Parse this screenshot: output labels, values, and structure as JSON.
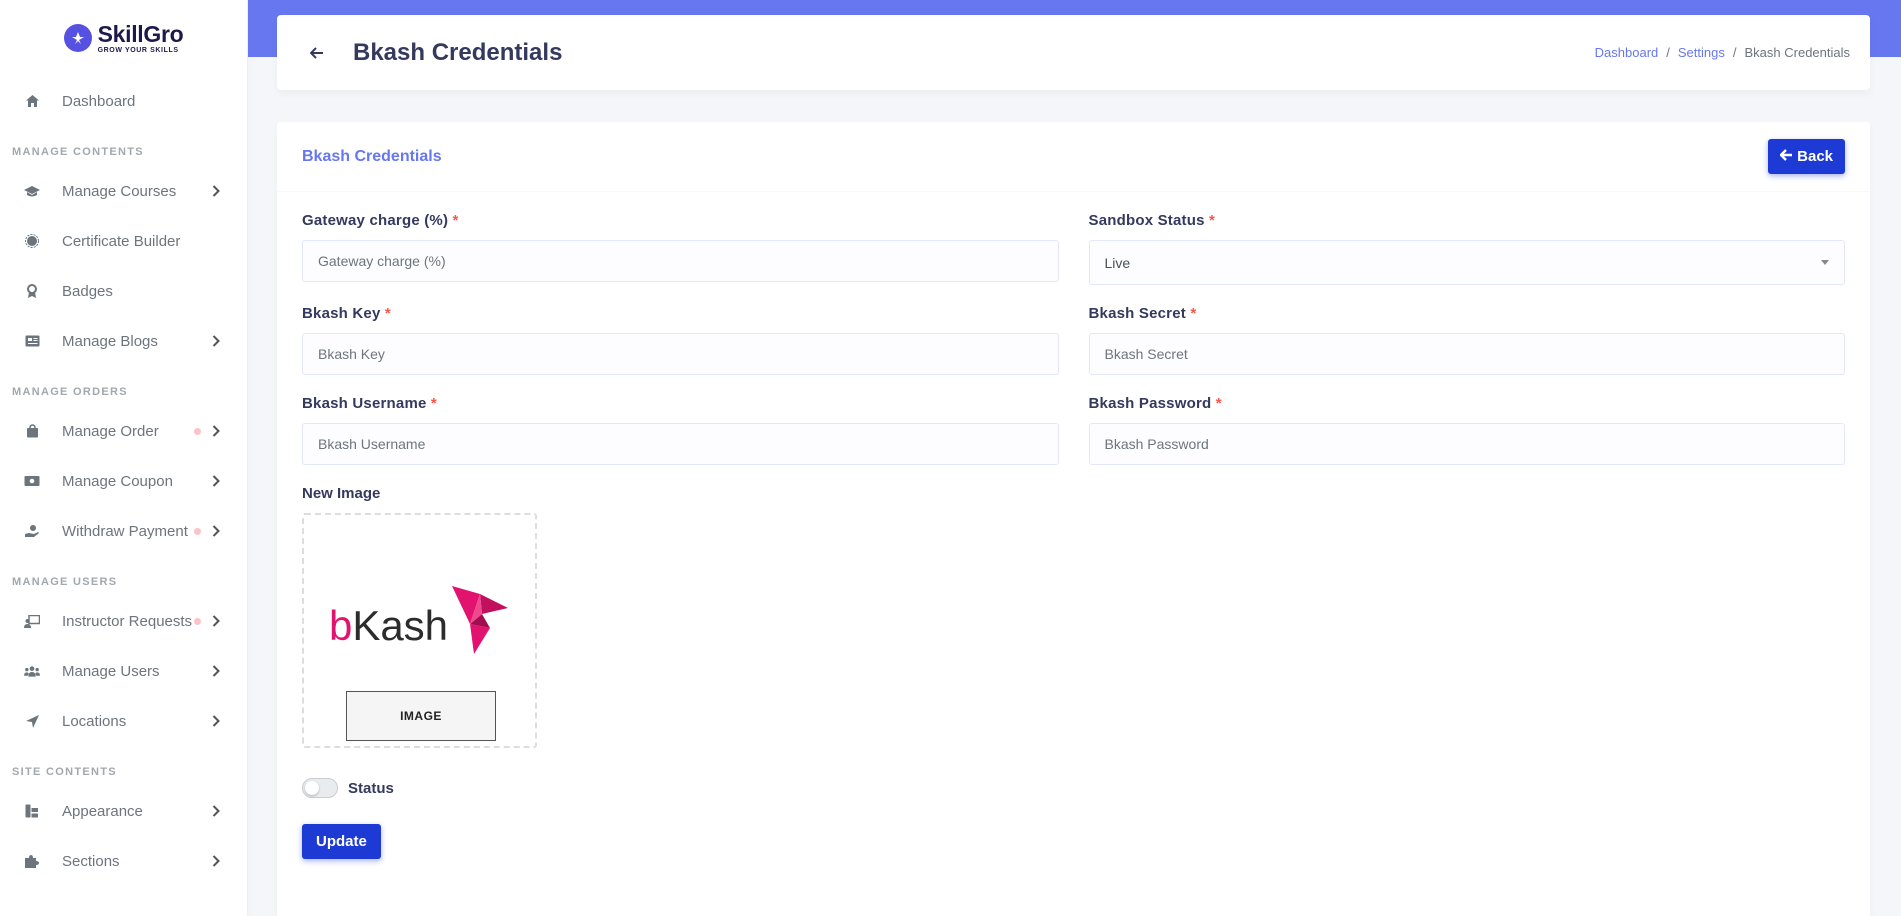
{
  "brand": {
    "mark": "★",
    "name": "SkillGro",
    "tagline": "GROW YOUR SKILLS",
    "color": "#5751e1"
  },
  "sidebar": {
    "dashboard": "Dashboard",
    "sections": [
      {
        "header": "MANAGE CONTENTS",
        "items": [
          {
            "label": "Manage Courses",
            "icon": "graduation-cap-icon",
            "chevron": true,
            "dot": false
          },
          {
            "label": "Certificate Builder",
            "icon": "certificate-icon",
            "chevron": false,
            "dot": false
          },
          {
            "label": "Badges",
            "icon": "award-icon",
            "chevron": false,
            "dot": false
          },
          {
            "label": "Manage Blogs",
            "icon": "newspaper-icon",
            "chevron": true,
            "dot": false
          }
        ]
      },
      {
        "header": "MANAGE ORDERS",
        "items": [
          {
            "label": "Manage Order",
            "icon": "shopping-bag-icon",
            "chevron": true,
            "dot": true
          },
          {
            "label": "Manage Coupon",
            "icon": "money-bill-icon",
            "chevron": true,
            "dot": false
          },
          {
            "label": "Withdraw Payment",
            "icon": "hand-holding-dollar-icon",
            "chevron": true,
            "dot": true
          }
        ]
      },
      {
        "header": "MANAGE USERS",
        "items": [
          {
            "label": "Instructor Requests",
            "icon": "chalkboard-user-icon",
            "chevron": true,
            "dot": true
          },
          {
            "label": "Manage Users",
            "icon": "users-icon",
            "chevron": true,
            "dot": false
          },
          {
            "label": "Locations",
            "icon": "location-arrow-icon",
            "chevron": true,
            "dot": false
          }
        ]
      },
      {
        "header": "SITE CONTENTS",
        "items": [
          {
            "label": "Appearance",
            "icon": "paint-roller-icon",
            "chevron": true,
            "dot": false
          },
          {
            "label": "Sections",
            "icon": "puzzle-piece-icon",
            "chevron": true,
            "dot": false
          }
        ]
      }
    ]
  },
  "header": {
    "title": "Bkash Credentials",
    "breadcrumb": [
      "Dashboard",
      "Settings",
      "Bkash Credentials"
    ],
    "accent": "#6777ef"
  },
  "card": {
    "title": "Bkash Credentials",
    "back_label": "Back"
  },
  "form": {
    "gateway_charge": {
      "label": "Gateway charge (%)",
      "placeholder": "Gateway charge (%)",
      "value": ""
    },
    "sandbox_status": {
      "label": "Sandbox Status",
      "value": "Live"
    },
    "bkash_key": {
      "label": "Bkash Key",
      "placeholder": "Bkash Key",
      "value": ""
    },
    "bkash_secret": {
      "label": "Bkash Secret",
      "placeholder": "Bkash Secret",
      "value": ""
    },
    "bkash_username": {
      "label": "Bkash Username",
      "placeholder": "Bkash Username",
      "value": ""
    },
    "bkash_password": {
      "label": "Bkash Password",
      "placeholder": "Bkash Password",
      "value": ""
    },
    "required_mark": "*",
    "image": {
      "label": "New Image",
      "button": "IMAGE",
      "logo_b": "b",
      "logo_rest": "Kash",
      "logo_color": "#e2136e"
    },
    "status": {
      "label": "Status",
      "on": false
    },
    "submit": "Update",
    "button_color": "#1d3bd4"
  }
}
